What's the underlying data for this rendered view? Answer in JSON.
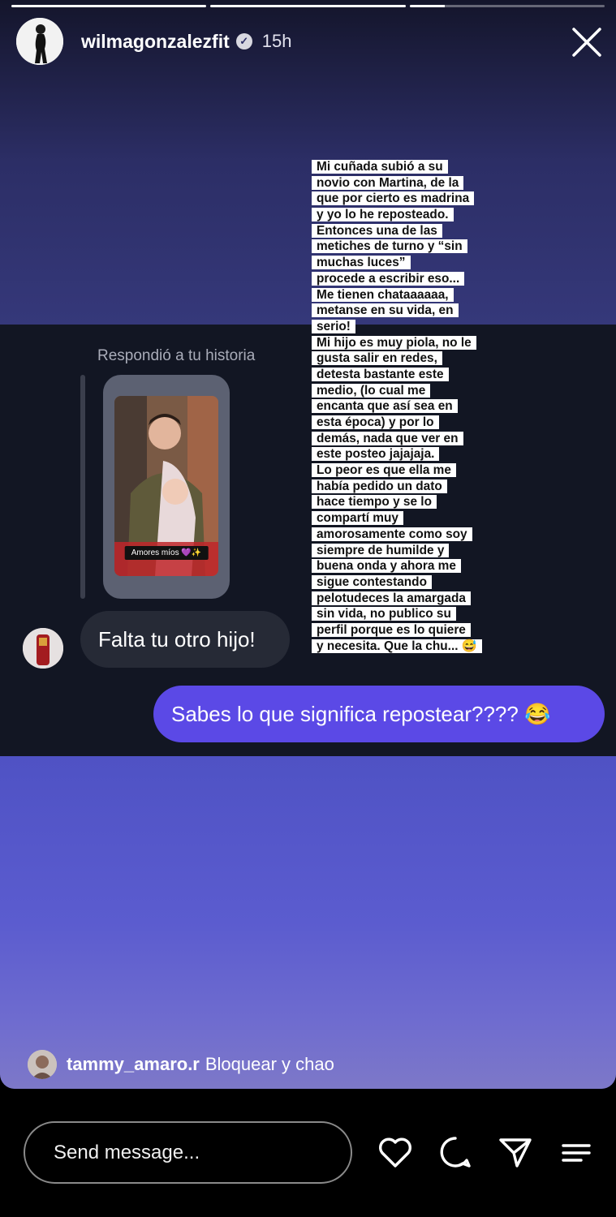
{
  "progress": [
    {
      "name": "segment-1",
      "fraction": 1.0
    },
    {
      "name": "segment-2",
      "fraction": 1.0
    },
    {
      "name": "segment-3",
      "fraction": 0.18
    }
  ],
  "header": {
    "username": "wilmagonzalezfit",
    "verified_icon": "verified-check-icon",
    "time": "15h",
    "close_icon": "close-icon"
  },
  "dm": {
    "replied_label": "Respondió a tu historia",
    "story_caption": "Amores míos 💜✨",
    "incoming_message": "Falta tu otro hijo!",
    "outgoing_message": "Sabes lo que significa repostear???? 😂"
  },
  "note_lines": [
    "Mi cuñada subió a su",
    "novio con Martina, de la",
    "que por cierto es madrina",
    "y yo lo he reposteado.",
    "Entonces una de las",
    "metiches de turno  y  “sin",
    "muchas luces”",
    "procede a escribir eso...",
    "Me tienen chataaaaaa,",
    "metanse en su vida, en",
    "serio!",
    "Mi hijo es muy piola, no le",
    "gusta salir en redes,",
    "detesta bastante este",
    "medio, (lo cual me",
    "encanta que así sea en",
    "esta época) y por lo",
    "demás, nada que ver en",
    "este posteo jajajaja.",
    "Lo peor es que ella me",
    "había pedido un dato",
    "hace tiempo y se lo",
    "compartí muy",
    "amorosamente como soy",
    "siempre de humilde y",
    "buena onda y ahora me",
    "sigue contestando",
    "pelotudeces la amargada",
    "sin vida, no publico su",
    "perfil porque es lo quiere",
    "y necesita. Que la chu... 😅"
  ],
  "mention": {
    "username": "tammy_amaro.r",
    "text": "Bloquear y chao"
  },
  "footer": {
    "message_placeholder": "Send message...",
    "icons": [
      "heart-icon",
      "comment-icon",
      "send-icon",
      "menu-icon"
    ]
  },
  "colors": {
    "outgoing_bubble": "#5b49e6",
    "incoming_bubble": "#262a36",
    "dm_background": "#121623"
  }
}
